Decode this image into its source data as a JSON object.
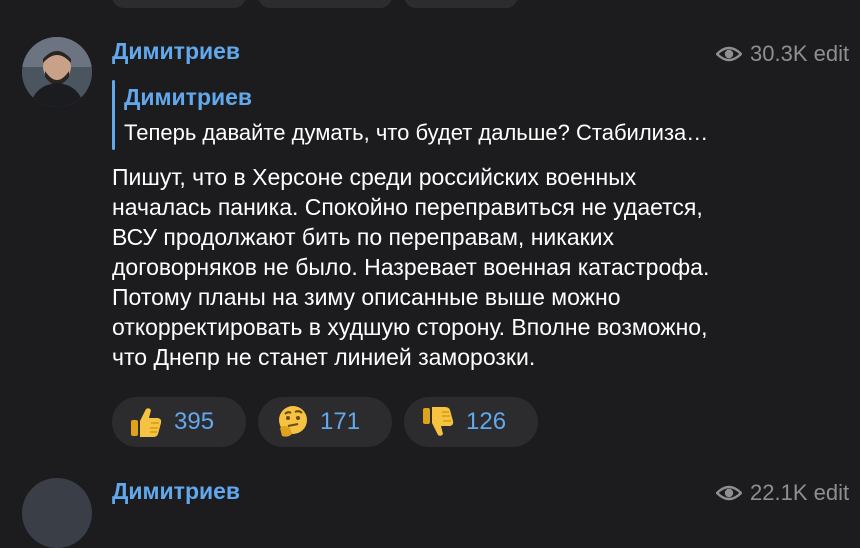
{
  "post": {
    "author": "Димитриев",
    "views": "30.3K edit",
    "reply": {
      "author": "Димитриев",
      "text": "Теперь давайте думать, что будет дальше? Стабилиза…"
    },
    "body_lines": [
      "Пишут, что в Херсоне среди российских военных",
      "началась паника. Спокойно переправиться не удается,",
      "ВСУ продолжают бить по переправам, никаких",
      "договорняков не было. Назревает военная катастрофа.",
      "Потому планы на зиму описанные выше можно",
      "откорректировать в худшую сторону. Вполне возможно,",
      "что Днепр не станет линией заморозки."
    ],
    "reactions": [
      {
        "icon": "thumbs-up-icon",
        "count": "395"
      },
      {
        "icon": "thinking-face-icon",
        "count": "171"
      },
      {
        "icon": "thumbs-down-icon",
        "count": "126"
      }
    ]
  },
  "next_post": {
    "author": "Димитриев",
    "views": "22.1K edit"
  },
  "colors": {
    "background": "#1c1c1e",
    "accent": "#62a8ec",
    "pill": "#2c2c2e",
    "muted": "#8e8e93"
  }
}
